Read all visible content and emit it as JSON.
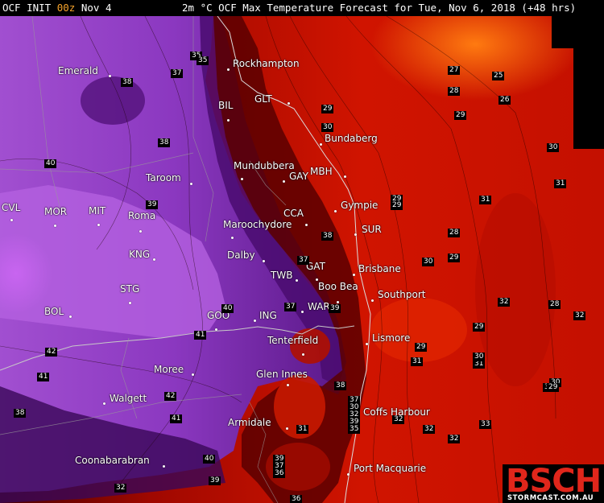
{
  "header": {
    "init_label": "OCF INIT",
    "run_label": "00z",
    "date_label": "Nov 4",
    "title": "2m °C OCF Max Temperature Forecast for Tue, Nov 6, 2018 (+48 hrs)"
  },
  "logo": {
    "brand": "BSCH",
    "site": "STORMCAST.COM.AU"
  },
  "palette": {
    "purple_light": "#b85ae0",
    "purple_mid": "#8d38c0",
    "purple_dark": "#5e1a8a",
    "purple_deep": "#3d0a5e",
    "dark_red": "#5a0000",
    "red": "#b80a00",
    "red_bright": "#e01e00",
    "orange": "#ff6a00"
  },
  "cities": [
    {
      "name": "Emerald"
    },
    {
      "name": "Rockhampton"
    },
    {
      "name": "BIL"
    },
    {
      "name": "GLT"
    },
    {
      "name": "Bundaberg"
    },
    {
      "name": "Taroom"
    },
    {
      "name": "Mundubbera"
    },
    {
      "name": "GAY"
    },
    {
      "name": "MBH"
    },
    {
      "name": "Gympie"
    },
    {
      "name": "CVL"
    },
    {
      "name": "MOR"
    },
    {
      "name": "MIT"
    },
    {
      "name": "Roma"
    },
    {
      "name": "KNG"
    },
    {
      "name": "CCA"
    },
    {
      "name": "Maroochydore"
    },
    {
      "name": "SUR"
    },
    {
      "name": "Dalby"
    },
    {
      "name": "GAT"
    },
    {
      "name": "TWB"
    },
    {
      "name": "Brisbane"
    },
    {
      "name": "Boo Bea"
    },
    {
      "name": "STG"
    },
    {
      "name": "Southport"
    },
    {
      "name": "BOL"
    },
    {
      "name": "WAR"
    },
    {
      "name": "GOO"
    },
    {
      "name": "ING"
    },
    {
      "name": "Tenterfield"
    },
    {
      "name": "Lismore"
    },
    {
      "name": "Moree"
    },
    {
      "name": "Glen Innes"
    },
    {
      "name": "Walgett"
    },
    {
      "name": "Coffs Harbour"
    },
    {
      "name": "Armidale"
    },
    {
      "name": "Coonabarabran"
    },
    {
      "name": "Port Macquarie"
    }
  ],
  "values": [
    "35",
    "35",
    "38",
    "37",
    "27",
    "25",
    "28",
    "26",
    "29",
    "38",
    "29",
    "30",
    "30",
    "40",
    "39",
    "31",
    "31",
    "29",
    "29",
    "38",
    "28",
    "37",
    "30",
    "29",
    "32",
    "28",
    "32",
    "37",
    "39",
    "40",
    "29",
    "41",
    "42",
    "29",
    "31",
    "31",
    "30",
    "30",
    "30",
    "29",
    "41",
    "38",
    "42",
    "37",
    "30",
    "32",
    "32",
    "39",
    "41",
    "35",
    "33",
    "32",
    "31",
    "38",
    "32",
    "40",
    "39",
    "37",
    "36",
    "39",
    "36",
    "32"
  ]
}
